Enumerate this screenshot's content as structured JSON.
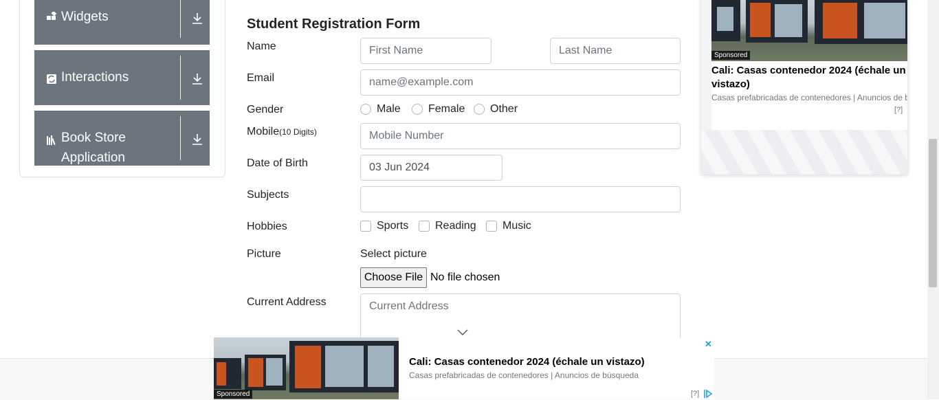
{
  "sidebar": {
    "groups": [
      {
        "label": "Widgets",
        "icon": "widgets-icon"
      },
      {
        "label": "Interactions",
        "icon": "interactions-icon"
      },
      {
        "label": "Book Store Application",
        "label_line1": "Book Store",
        "label_line2": "Application",
        "icon": "book-store-icon"
      }
    ],
    "expand_icon": "download-arrow-icon",
    "header_color": "#6c757d"
  },
  "form": {
    "title": "Student Registration Form",
    "name": {
      "label": "Name",
      "first_placeholder": "First Name",
      "last_placeholder": "Last Name"
    },
    "email": {
      "label": "Email",
      "placeholder": "name@example.com"
    },
    "gender": {
      "label": "Gender",
      "options": [
        "Male",
        "Female",
        "Other"
      ]
    },
    "mobile": {
      "label": "Mobile",
      "hint": "(10 Digits)",
      "placeholder": "Mobile Number"
    },
    "dob": {
      "label": "Date of Birth",
      "value": "03 Jun 2024"
    },
    "subjects": {
      "label": "Subjects",
      "value": ""
    },
    "hobbies": {
      "label": "Hobbies",
      "options": [
        "Sports",
        "Reading",
        "Music"
      ]
    },
    "picture": {
      "label": "Picture",
      "select_label": "Select picture",
      "button": "Choose File",
      "status": "No file chosen"
    },
    "address": {
      "label": "Current Address",
      "placeholder": "Current Address"
    }
  },
  "right_ad": {
    "sponsored": "Sponsored",
    "headline": "Cali: Casas contenedor 2024 (échale un vistazo)",
    "subtext": "Casas prefabricadas de contenedores | Anuncios de b...",
    "help": "[?]"
  },
  "bottom_ad": {
    "sponsored": "Sponsored",
    "headline": "Cali: Casas contenedor 2024 (échale un vistazo)",
    "subtext": "Casas prefabricadas de contenedores | Anuncios de búsqueda",
    "help": "[?]",
    "close": "✕"
  },
  "colors": {
    "adchoices": "#1fa6d8",
    "border": "#ced4da"
  }
}
